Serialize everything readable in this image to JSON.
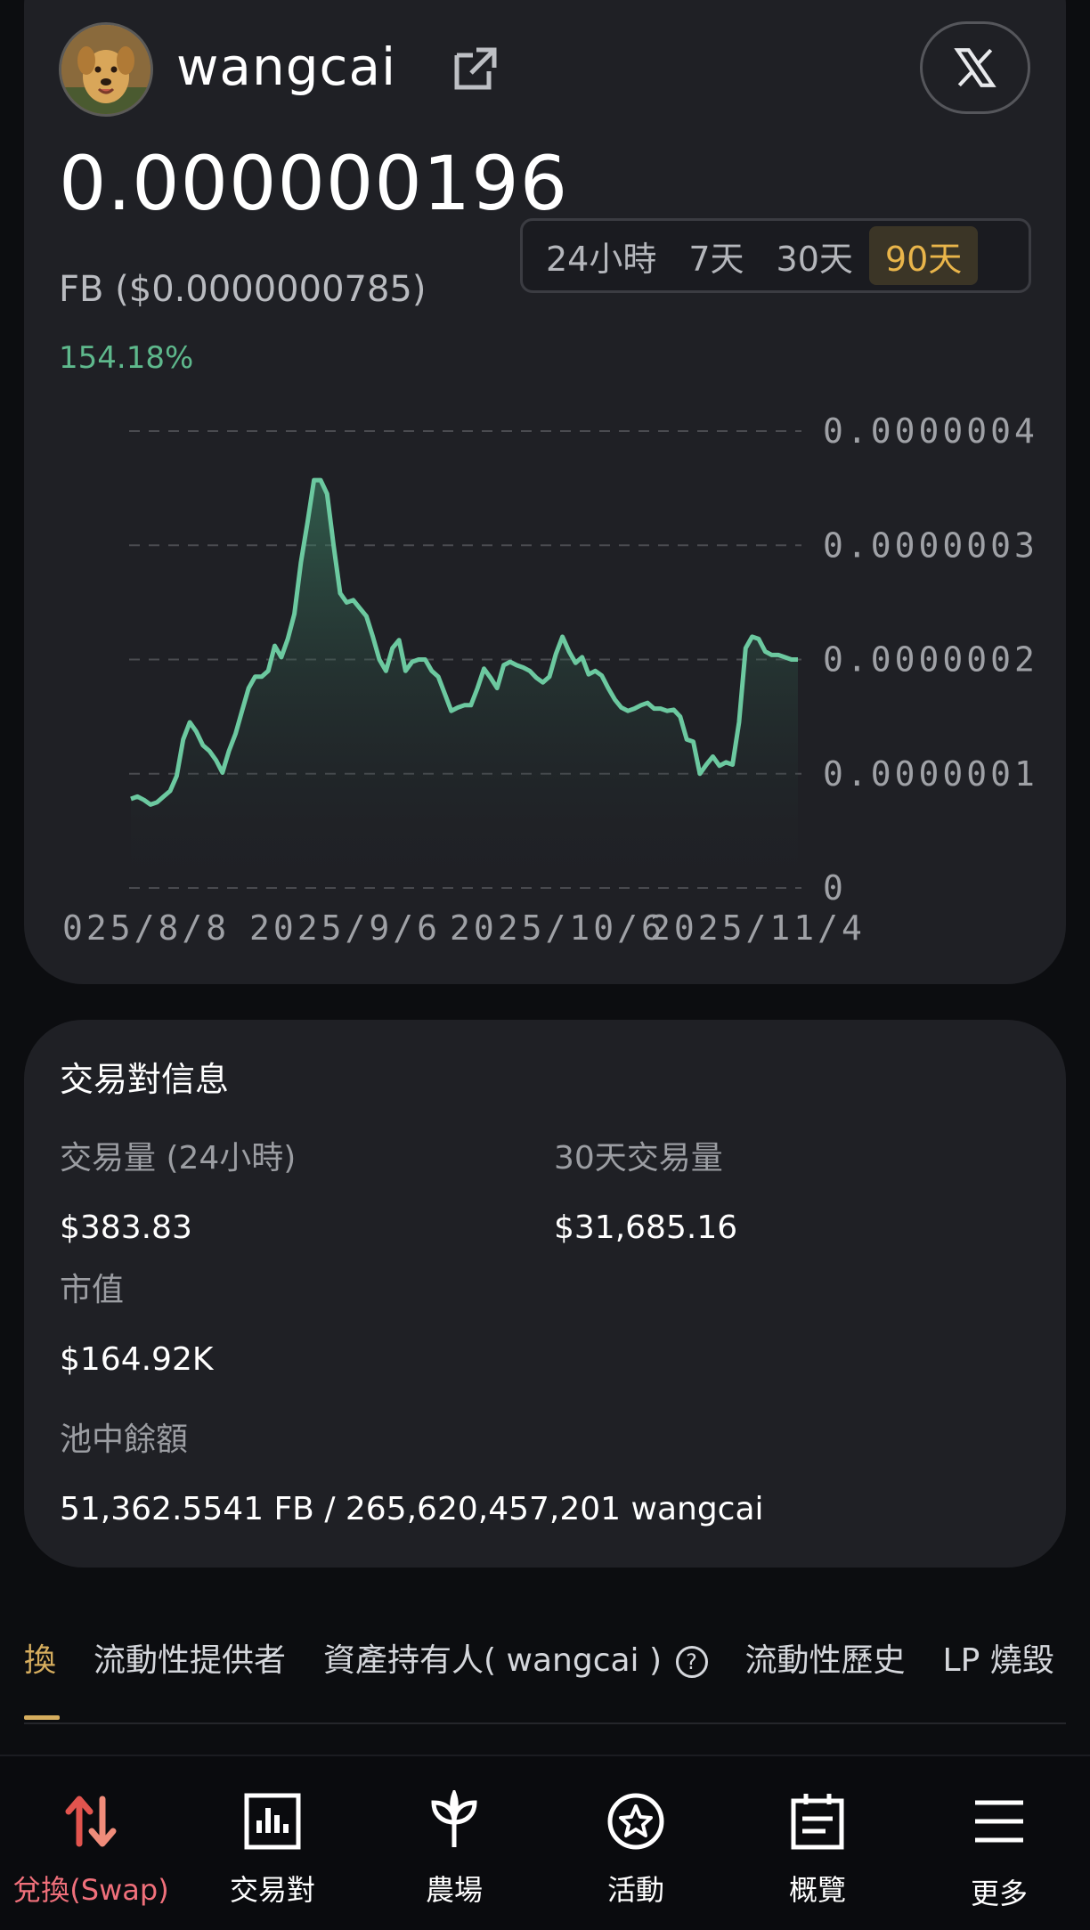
{
  "token": {
    "name": "wangcai",
    "price": "0.000000196",
    "price_fb": "FB ($0.0000000785)",
    "change": "154.18%"
  },
  "ranges": [
    "24小時",
    "7天",
    "30天",
    "90天"
  ],
  "active_range": "90天",
  "icons": {
    "external_link": "external-link-icon",
    "x_logo": "x-logo-icon",
    "help": "help-icon"
  },
  "colors": {
    "accent_gold": "#e9b54a",
    "positive": "#5eb88c",
    "line": "#6cc9a0",
    "active_nav": "#f0707b"
  },
  "chart_data": {
    "type": "area",
    "y_ticks": [
      "0.0000004",
      "0.0000003",
      "0.0000002",
      "0.0000001",
      "0"
    ],
    "x_ticks": [
      "025/8/8",
      "2025/9/6",
      "2025/10/6",
      "2025/11/4"
    ],
    "ylim": [
      0,
      4e-07
    ],
    "grid": true,
    "values": [
      0.078,
      0.08,
      0.077,
      0.073,
      0.075,
      0.08,
      0.085,
      0.098,
      0.13,
      0.145,
      0.137,
      0.125,
      0.12,
      0.112,
      0.101,
      0.12,
      0.135,
      0.155,
      0.175,
      0.185,
      0.185,
      0.19,
      0.212,
      0.202,
      0.218,
      0.24,
      0.285,
      0.32,
      0.357,
      0.357,
      0.345,
      0.3,
      0.258,
      0.25,
      0.252,
      0.245,
      0.238,
      0.22,
      0.2,
      0.19,
      0.21,
      0.217,
      0.19,
      0.198,
      0.2,
      0.2,
      0.19,
      0.185,
      0.17,
      0.155,
      0.158,
      0.16,
      0.16,
      0.175,
      0.192,
      0.184,
      0.175,
      0.195,
      0.198,
      0.195,
      0.193,
      0.19,
      0.184,
      0.18,
      0.185,
      0.205,
      0.22,
      0.207,
      0.197,
      0.202,
      0.187,
      0.19,
      0.186,
      0.175,
      0.165,
      0.158,
      0.155,
      0.157,
      0.16,
      0.162,
      0.157,
      0.157,
      0.155,
      0.156,
      0.15,
      0.13,
      0.128,
      0.1,
      0.108,
      0.115,
      0.107,
      0.11,
      0.108,
      0.145,
      0.21,
      0.22,
      0.218,
      0.207,
      0.204,
      0.204,
      0.202,
      0.2,
      0.2
    ],
    "value_scale": "1e-6"
  },
  "pair_info": {
    "title": "交易對信息",
    "volume_24h_label": "交易量 (24小時)",
    "volume_24h": "$383.83",
    "volume_30d_label": "30天交易量",
    "volume_30d": "$31,685.16",
    "market_cap_label": "市值",
    "market_cap": "$164.92K",
    "pool_label": "池中餘額",
    "pool_value": "51,362.5541 FB / 265,620,457,201 wangcai"
  },
  "tabs": {
    "swap": "換",
    "lp_providers": "流動性提供者",
    "holders": "資產持有人( wangcai )",
    "liquidity_history": "流動性歷史",
    "lp_burn": "LP 燒毀"
  },
  "nav": {
    "swap": "兌換(Swap)",
    "pairs": "交易對",
    "farm": "農場",
    "events": "活動",
    "overview": "概覽",
    "more": "更多"
  }
}
